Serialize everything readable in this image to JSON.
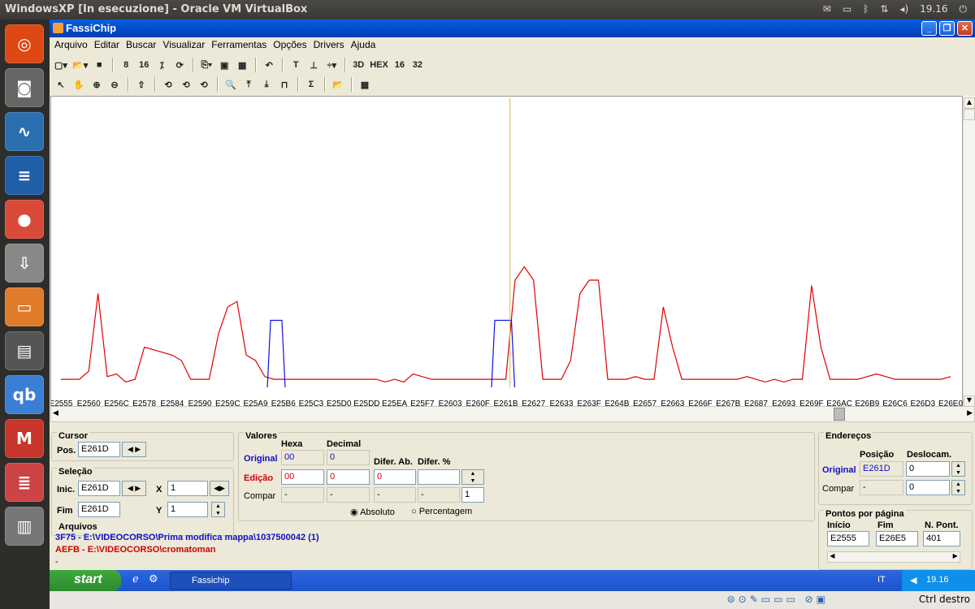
{
  "host": {
    "title": "WindowsXP [In esecuzione] - Oracle VM VirtualBox",
    "clock": "19.16",
    "host_key": "Ctrl destro"
  },
  "launcher": [
    {
      "name": "ubuntu-dash-icon",
      "color": "#dd4814",
      "glyph": "◎"
    },
    {
      "name": "camera-icon",
      "color": "#666",
      "glyph": "◙"
    },
    {
      "name": "system-monitor-icon",
      "color": "#2a6fb0",
      "glyph": "∿"
    },
    {
      "name": "writer-icon",
      "color": "#1f5fa8",
      "glyph": "≡"
    },
    {
      "name": "chrome-icon",
      "color": "#d94a38",
      "glyph": "●"
    },
    {
      "name": "installer-icon",
      "color": "#888",
      "glyph": "⇩"
    },
    {
      "name": "files-icon",
      "color": "#e07b2a",
      "glyph": "▭"
    },
    {
      "name": "scanner-icon",
      "color": "#555",
      "glyph": "▤"
    },
    {
      "name": "qbittorrent-icon",
      "color": "#3a7fd5",
      "glyph": "qb"
    },
    {
      "name": "gmail-icon",
      "color": "#c8352a",
      "glyph": "M"
    },
    {
      "name": "stack-icon",
      "color": "#c44",
      "glyph": "≣"
    },
    {
      "name": "trash-icon",
      "color": "#777",
      "glyph": "▥"
    }
  ],
  "app": {
    "title": "FassiChip",
    "menu": [
      "Arquivo",
      "Editar",
      "Buscar",
      "Visualizar",
      "Ferramentas",
      "Opções",
      "Drivers",
      "Ajuda"
    ]
  },
  "toolbar1": [
    "▢▾",
    "📂▾",
    "■",
    "8",
    "16",
    "⁒",
    "⟳",
    "⎘▾",
    "▣",
    "▦",
    "↶",
    "T",
    "⊥",
    "÷▾",
    "3D",
    "HEX",
    "16",
    "32"
  ],
  "toolbar2": [
    "↖",
    "✋",
    "⊕",
    "⊖",
    "⇧",
    "⟲",
    "⟲",
    "⟲",
    "🔍",
    "⤒",
    "⤓",
    "⊓",
    "Σ",
    "📂",
    "▦"
  ],
  "chart_data": {
    "type": "line",
    "x_ticks": [
      "E2555",
      "E2560",
      "E256C",
      "E2578",
      "E2584",
      "E2590",
      "E259C",
      "E25A9",
      "E25B6",
      "E25C3",
      "E25D0",
      "E25DD",
      "E25EA",
      "E25F7",
      "E2603",
      "E260F",
      "E261B",
      "E2627",
      "E2633",
      "E263F",
      "E264B",
      "E2657",
      "E2663",
      "E266F",
      "E267B",
      "E2687",
      "E2693",
      "E269F",
      "E26AC",
      "E26B9",
      "E26C6",
      "E26D3",
      "E26E0"
    ],
    "cursor": "E261D",
    "series": [
      {
        "color": "#e00000",
        "y": [
          3,
          3,
          3,
          6,
          35,
          4,
          5,
          2,
          3,
          15,
          14,
          13,
          12,
          10,
          3,
          3,
          3,
          20,
          30,
          32,
          12,
          10,
          4,
          3,
          3,
          3,
          3,
          3,
          3,
          3,
          3,
          3,
          3,
          3,
          3,
          2,
          3,
          2,
          5,
          4,
          3,
          3,
          3,
          3,
          3,
          3,
          3,
          3,
          3,
          40,
          45,
          40,
          3,
          3,
          3,
          10,
          35,
          40,
          40,
          3,
          3,
          3,
          4,
          3,
          3,
          30,
          15,
          3,
          3,
          3,
          3,
          3,
          3,
          3,
          4,
          3,
          2,
          3,
          2,
          3,
          3,
          38,
          15,
          3,
          3,
          3,
          3,
          4,
          5,
          4,
          3,
          3,
          3,
          3,
          3,
          3,
          4
        ]
      },
      {
        "color": "#1010e0",
        "segments": [
          [
            0.232,
            0.252
          ],
          [
            0.484,
            0.51
          ]
        ],
        "level": 25
      }
    ],
    "ylim": [
      0,
      100
    ]
  },
  "cursor": {
    "title": "Cursor",
    "pos_label": "Pos.",
    "pos": "E261D"
  },
  "selecao": {
    "title": "Seleção",
    "inic_label": "Inic.",
    "inic": "E261D",
    "fim_label": "Fim",
    "fim": "E261D",
    "x_label": "X",
    "x": "1",
    "y_label": "Y",
    "y": "1"
  },
  "valores": {
    "title": "Valores",
    "hexa": "Hexa",
    "decimal": "Decimal",
    "difab": "Difer. Ab.",
    "difpct": "Difer. %",
    "original": "Original",
    "edicao": "Edição",
    "compar": "Compar",
    "orig_hex": "00",
    "orig_dec": "0",
    "ed_hex": "00",
    "ed_dec": "0",
    "ed_difab": "0",
    "ed_difpct": "",
    "cmp_hex": "-",
    "cmp_dec": "-",
    "cmp_difab": "-",
    "cmp_difpct": "-",
    "step": "1",
    "abs": "Absoluto",
    "pct": "Percentagem"
  },
  "arquivos": {
    "title": "Arquivos",
    "f1": "3F75 - E:\\VIDEOCORSO\\Prima modifica mappa\\1037500042 (1)",
    "f2": "AEFB - E:\\VIDEOCORSO\\cromatoman",
    "f3": "-"
  },
  "enderecos": {
    "title": "Endereços",
    "posicao": "Posição",
    "desloc": "Deslocam.",
    "original": "Original",
    "compar": "Compar",
    "orig_pos": "E261D",
    "orig_desl": "0",
    "cmp_pos": "-",
    "cmp_desl": "0"
  },
  "pontos": {
    "title": "Pontos por página",
    "inicio": "Início",
    "fim": "Fim",
    "npont": "N. Pont.",
    "v_inicio": "E2555",
    "v_fim": "E26E5",
    "v_npont": "401"
  },
  "taskbar": {
    "start": "start",
    "task": "Fassichip",
    "lang": "IT",
    "clock": "19.16"
  }
}
